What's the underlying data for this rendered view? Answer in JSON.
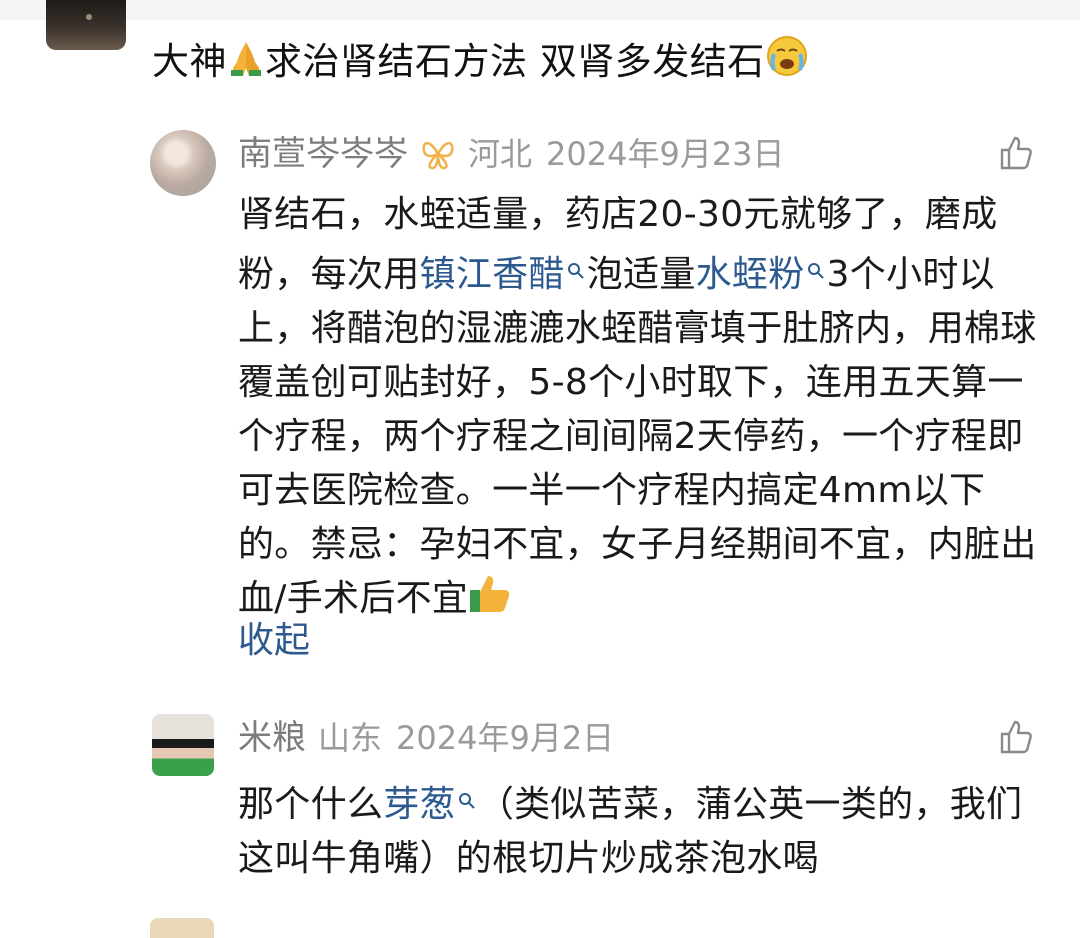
{
  "question": {
    "text_before": "大神",
    "text_after": "求治肾结石方法 双肾多发结石",
    "emoji_pray": "praying-hands-emoji",
    "emoji_cry": "crying-face-emoji"
  },
  "comments": [
    {
      "author": "南萱岑岑岑",
      "badge": "butterfly-badge-icon",
      "location": "河北",
      "date": "2024年9月23日",
      "segments": [
        {
          "text": "肾结石，水蛭适量，药店20-30元就够了，磨成粉，每次用",
          "link": false
        },
        {
          "text": "镇江香醋",
          "link": true
        },
        {
          "text": "泡适量",
          "link": false
        },
        {
          "text": "水蛭粉",
          "link": true
        },
        {
          "text": "3个小时以上，将醋泡的湿漉漉水蛭醋膏填于肚脐内，用棉球覆盖创可贴封好，5-8个小时取下，连用五天算一个疗程，两个疗程之间间隔2天停药，一个疗程即可去医院检查。一半一个疗程内搞定4mm以下的。禁忌：孕妇不宜，女子月经期间不宜，内脏出血/手术后不宜",
          "link": false
        }
      ],
      "trailing_emoji": "thumbs-up-emoji",
      "collapse_label": "收起"
    },
    {
      "author": "米粮",
      "location": "山东",
      "date": "2024年9月2日",
      "segments": [
        {
          "text": "那个什么",
          "link": false
        },
        {
          "text": "芽葱",
          "link": true
        },
        {
          "text": "（类似苦菜，蒲公英一类的，我们这叫牛角嘴）的根切片炒成茶泡水喝",
          "link": false
        }
      ]
    }
  ],
  "colors": {
    "link": "#2c5a8f",
    "meta": "#9a9a9a",
    "text": "#1a1a1a"
  }
}
